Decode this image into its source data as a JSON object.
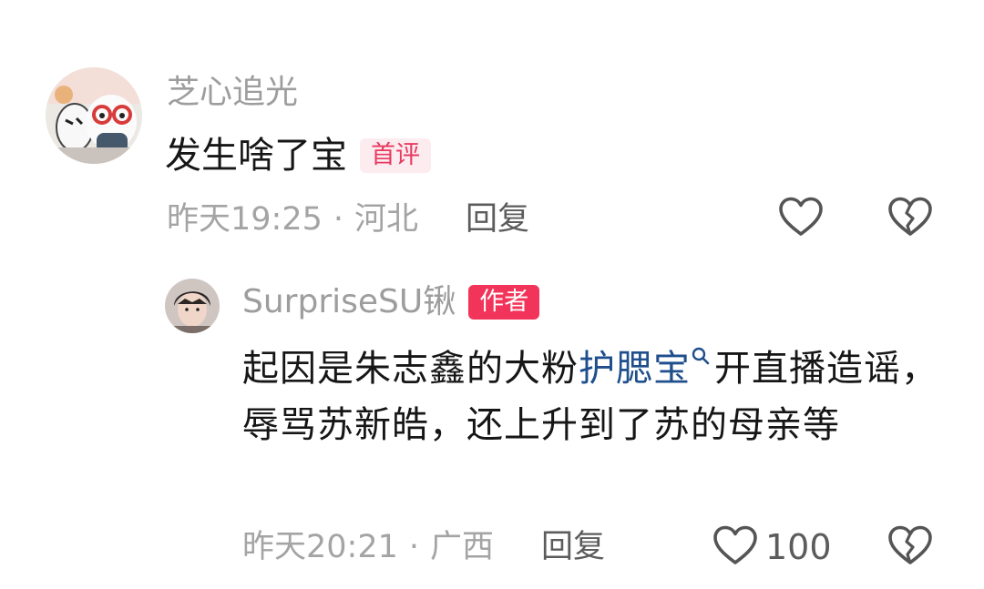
{
  "comment": {
    "username": "芝心追光",
    "text": "发生啥了宝",
    "badge": "首评",
    "time": "昨天19:25",
    "separator": "·",
    "location": "河北",
    "reply_label": "回复"
  },
  "reply": {
    "username": "SurpriseSU锹",
    "badge": "作者",
    "text_before": "起因是朱志鑫的大粉",
    "mention": "护腮宝",
    "text_after": "开直播造谣，辱骂苏新皓，还上升到了苏的母亲等",
    "time": "昨天20:21",
    "separator": "·",
    "location": "广西",
    "reply_label": "回复",
    "like_count": "100"
  },
  "icons": {
    "like": "heart-outline-icon",
    "dislike": "broken-heart-icon",
    "mention_search": "search-icon"
  },
  "colors": {
    "badge_first_bg": "#fdecef",
    "badge_first_text": "#e73a60",
    "badge_author_bg": "#f2345a",
    "mention": "#1f4f8c",
    "meta_gray": "#a4a4a4"
  }
}
